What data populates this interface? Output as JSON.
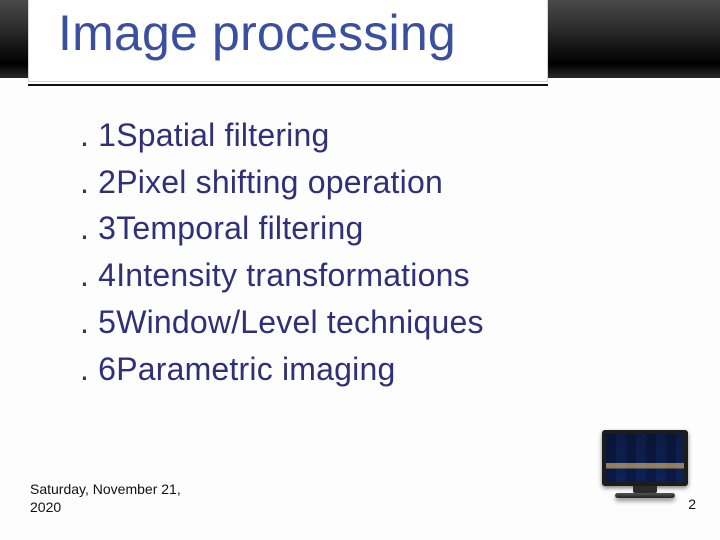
{
  "title": "Image processing",
  "items": [
    {
      "num": ". 1",
      "text": "Spatial filtering"
    },
    {
      "num": ". 2",
      "text": "Pixel shifting operation"
    },
    {
      "num": ". 3",
      "text": "Temporal filtering"
    },
    {
      "num": ". 4",
      "text": "Intensity transformations"
    },
    {
      "num": ". 5",
      "text": "Window/Level techniques"
    },
    {
      "num": ". 6",
      "text": "Parametric imaging"
    }
  ],
  "footer": {
    "date": "Saturday, November 21, 2020",
    "page": "2"
  }
}
